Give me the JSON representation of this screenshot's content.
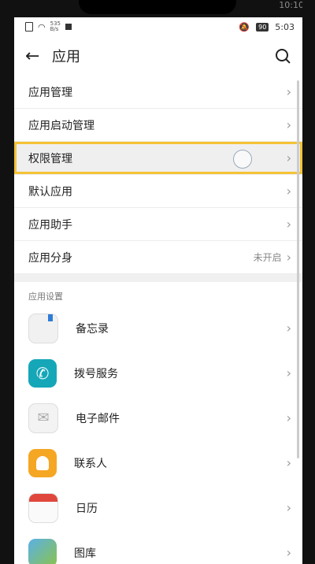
{
  "bezel": {
    "clock": "10:10"
  },
  "status_bar": {
    "net_speed_value": "535",
    "net_speed_unit": "B/s",
    "battery": "90",
    "time": "5:03"
  },
  "header": {
    "back_icon": "←",
    "title": "应用"
  },
  "menu": [
    {
      "label": "应用管理"
    },
    {
      "label": "应用启动管理"
    },
    {
      "label": "权限管理"
    },
    {
      "label": "默认应用"
    },
    {
      "label": "应用助手"
    },
    {
      "label": "应用分身",
      "value": "未开启"
    }
  ],
  "section": {
    "title": "应用设置"
  },
  "apps": [
    {
      "label": "备忘录",
      "icon": "memo-icon"
    },
    {
      "label": "拨号服务",
      "icon": "phone-icon"
    },
    {
      "label": "电子邮件",
      "icon": "mail-icon"
    },
    {
      "label": "联系人",
      "icon": "contact-icon"
    },
    {
      "label": "日历",
      "icon": "calendar-icon"
    },
    {
      "label": "图库",
      "icon": "gallery-icon"
    }
  ],
  "colors": {
    "highlight": "#f5c336",
    "phone": "#15a7b8",
    "contact": "#f5a623",
    "calendar": "#e0473c"
  }
}
